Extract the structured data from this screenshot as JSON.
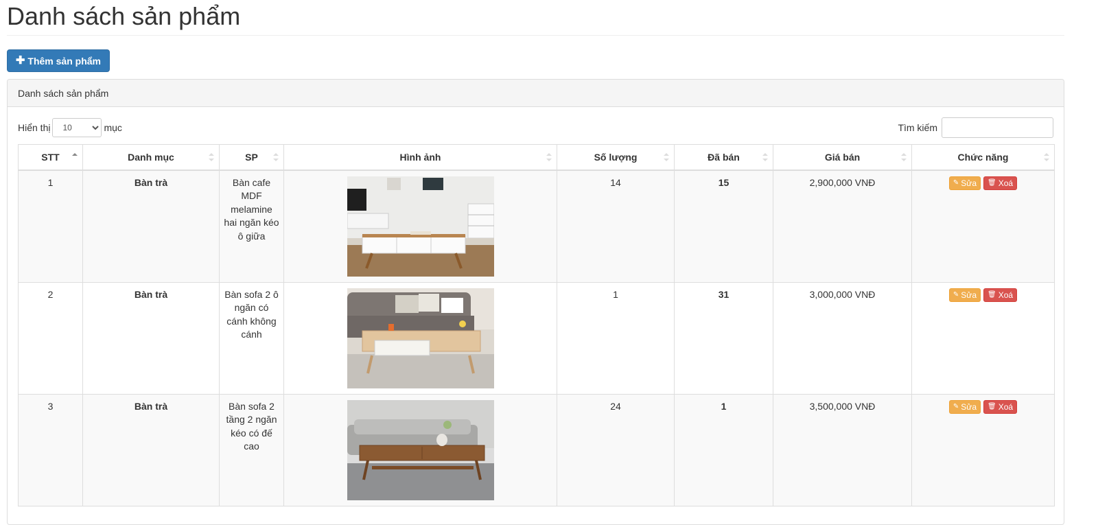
{
  "page": {
    "title": "Danh sách sản phẩm"
  },
  "toolbar": {
    "add_label": "Thêm sản phẩm",
    "add_icon": "plus-icon"
  },
  "panel": {
    "heading": "Danh sách sản phẩm"
  },
  "controls": {
    "show_label": "Hiển thị",
    "page_length": "10",
    "entries_label": "mục",
    "search_label": "Tìm kiếm",
    "search_value": ""
  },
  "table": {
    "columns": [
      "STT",
      "Danh mục",
      "SP",
      "Hình ảnh",
      "Số lượng",
      "Đã bán",
      "Giá bán",
      "Chức năng"
    ],
    "sorted_column": "STT",
    "rows": [
      {
        "stt": "1",
        "category": "Bàn trà",
        "name": "Bàn cafe MDF melamine hai ngăn kéo ô giữa",
        "image": "white-coffee-table-photo",
        "qty": "14",
        "sold": "15",
        "price": "2,900,000 VNĐ"
      },
      {
        "stt": "2",
        "category": "Bàn trà",
        "name": "Bàn sofa 2 ô ngăn có cánh không cánh",
        "image": "oak-coffee-table-sofa-photo",
        "qty": "1",
        "sold": "31",
        "price": "3,000,000 VNĐ"
      },
      {
        "stt": "3",
        "category": "Bàn trà",
        "name": "Bàn sofa 2 tầng 2 ngăn kéo có đế cao",
        "image": "walnut-coffee-table-photo",
        "qty": "24",
        "sold": "1",
        "price": "3,500,000 VNĐ"
      }
    ],
    "edit_label": "Sửa",
    "delete_label": "Xoá",
    "edit_icon": "edit-icon",
    "delete_icon": "trash-icon"
  },
  "colors": {
    "primary": "#337ab7",
    "warning": "#f0ad4e",
    "danger": "#d9534f",
    "category": "#c9302c"
  }
}
